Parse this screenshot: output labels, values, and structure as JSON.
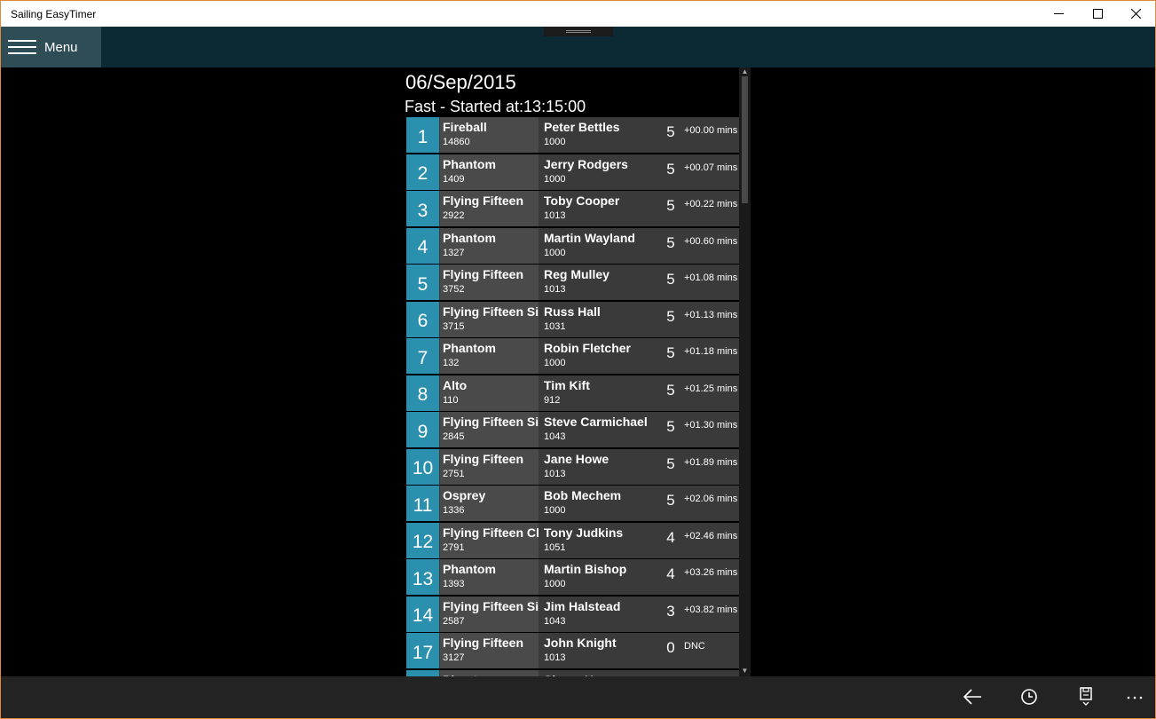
{
  "window": {
    "title": "Sailing EasyTimer"
  },
  "header": {
    "menu_label": "Menu"
  },
  "race": {
    "date": "06/Sep/2015",
    "title": "Fast  - Started at:13:15:00"
  },
  "results": [
    {
      "pos": "1",
      "boat_class": "Fireball",
      "sail_no": "14860",
      "helm": "Peter Bettles",
      "handicap": "1000",
      "laps": "5",
      "delta": "+00.00 mins"
    },
    {
      "pos": "2",
      "boat_class": "Phantom",
      "sail_no": "1409",
      "helm": "Jerry Rodgers",
      "handicap": "1000",
      "laps": "5",
      "delta": "+00.07 mins"
    },
    {
      "pos": "3",
      "boat_class": "Flying Fifteen",
      "sail_no": "2922",
      "helm": "Toby Cooper",
      "handicap": "1013",
      "laps": "5",
      "delta": "+00.22 mins"
    },
    {
      "pos": "4",
      "boat_class": "Phantom",
      "sail_no": "1327",
      "helm": "Martin Wayland",
      "handicap": "1000",
      "laps": "5",
      "delta": "+00.60 mins"
    },
    {
      "pos": "5",
      "boat_class": "Flying Fifteen",
      "sail_no": "3752",
      "helm": "Reg Mulley",
      "handicap": "1013",
      "laps": "5",
      "delta": "+01.08 mins"
    },
    {
      "pos": "6",
      "boat_class": "Flying Fifteen Silv",
      "sail_no": "3715",
      "helm": "Russ Hall",
      "handicap": "1031",
      "laps": "5",
      "delta": "+01.13 mins"
    },
    {
      "pos": "7",
      "boat_class": "Phantom",
      "sail_no": "132",
      "helm": "Robin Fletcher",
      "handicap": "1000",
      "laps": "5",
      "delta": "+01.18 mins"
    },
    {
      "pos": "8",
      "boat_class": "Alto",
      "sail_no": "110",
      "helm": "Tim Kift",
      "handicap": "912",
      "laps": "5",
      "delta": "+01.25 mins"
    },
    {
      "pos": "9",
      "boat_class": "Flying Fifteen Silv",
      "sail_no": "2845",
      "helm": "Steve Carmichael",
      "handicap": "1043",
      "laps": "5",
      "delta": "+01.30 mins"
    },
    {
      "pos": "10",
      "boat_class": "Flying Fifteen",
      "sail_no": "2751",
      "helm": "Jane Howe",
      "handicap": "1013",
      "laps": "5",
      "delta": "+01.89 mins"
    },
    {
      "pos": "11",
      "boat_class": "Osprey",
      "sail_no": "1336",
      "helm": "Bob Mechem",
      "handicap": "1000",
      "laps": "5",
      "delta": "+02.06 mins"
    },
    {
      "pos": "12",
      "boat_class": "Flying Fifteen Cla",
      "sail_no": "2791",
      "helm": "Tony Judkins",
      "handicap": "1051",
      "laps": "4",
      "delta": "+02.46 mins"
    },
    {
      "pos": "13",
      "boat_class": "Phantom",
      "sail_no": "1393",
      "helm": "Martin Bishop",
      "handicap": "1000",
      "laps": "4",
      "delta": "+03.26 mins"
    },
    {
      "pos": "14",
      "boat_class": "Flying Fifteen Silv",
      "sail_no": "2587",
      "helm": "Jim Halstead",
      "handicap": "1043",
      "laps": "3",
      "delta": "+03.82 mins"
    },
    {
      "pos": "17",
      "boat_class": "Flying Fifteen",
      "sail_no": "3127",
      "helm": "John Knight",
      "handicap": "1013",
      "laps": "0",
      "delta": "DNC"
    },
    {
      "pos": "",
      "boat_class": "Phantom",
      "sail_no": "",
      "helm": "Shane H",
      "handicap": "",
      "laps": "",
      "delta": ""
    }
  ],
  "icons": {
    "back": "back-arrow-icon",
    "history": "clock-icon",
    "save": "save-icon",
    "more": "more-icon"
  },
  "colors": {
    "accent": "#2b8fae",
    "header_bg": "#0b2a33",
    "menu_bg": "#2e4d57"
  }
}
